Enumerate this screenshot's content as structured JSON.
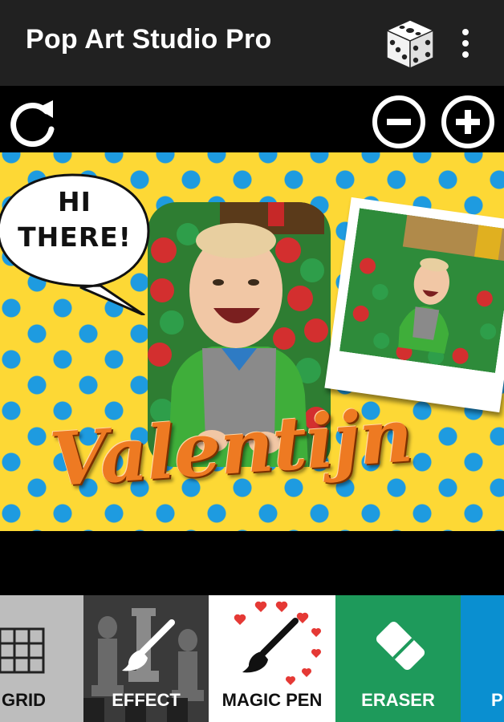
{
  "app": {
    "title": "Pop Art Studio Pro"
  },
  "appbar": {
    "actions": [
      {
        "name": "dice-icon",
        "label": "random"
      },
      {
        "name": "overflow-menu-icon",
        "label": "more"
      }
    ]
  },
  "toolbar": {
    "left": [
      {
        "name": "rotate-icon"
      }
    ],
    "right": [
      {
        "name": "zoom-out-icon"
      },
      {
        "name": "zoom-in-icon"
      }
    ]
  },
  "canvas": {
    "background_color": "#FDD835",
    "dot_color": "#1E9BE0",
    "speech_bubble": {
      "line1": "HI",
      "line2": "THERE!"
    },
    "name_text": "Valentijn"
  },
  "tools": [
    {
      "id": "grid",
      "label": "GRID",
      "icon": "grid-icon",
      "bg": "#BDBDBD",
      "fg": "#111111"
    },
    {
      "id": "effect",
      "label": "EFFECT",
      "icon": "paintbrush-icon",
      "bg": "#3A3A3A",
      "fg": "#FFFFFF"
    },
    {
      "id": "magic_pen",
      "label": "MAGIC PEN",
      "icon": "pen-hearts-icon",
      "bg": "#FFFFFF",
      "fg": "#111111"
    },
    {
      "id": "eraser",
      "label": "ERASER",
      "icon": "eraser-icon",
      "bg": "#1E9A5B",
      "fg": "#FFFFFF"
    },
    {
      "id": "partial",
      "label": "P",
      "icon": "",
      "bg": "#0A8FD0",
      "fg": "#FFFFFF"
    }
  ]
}
